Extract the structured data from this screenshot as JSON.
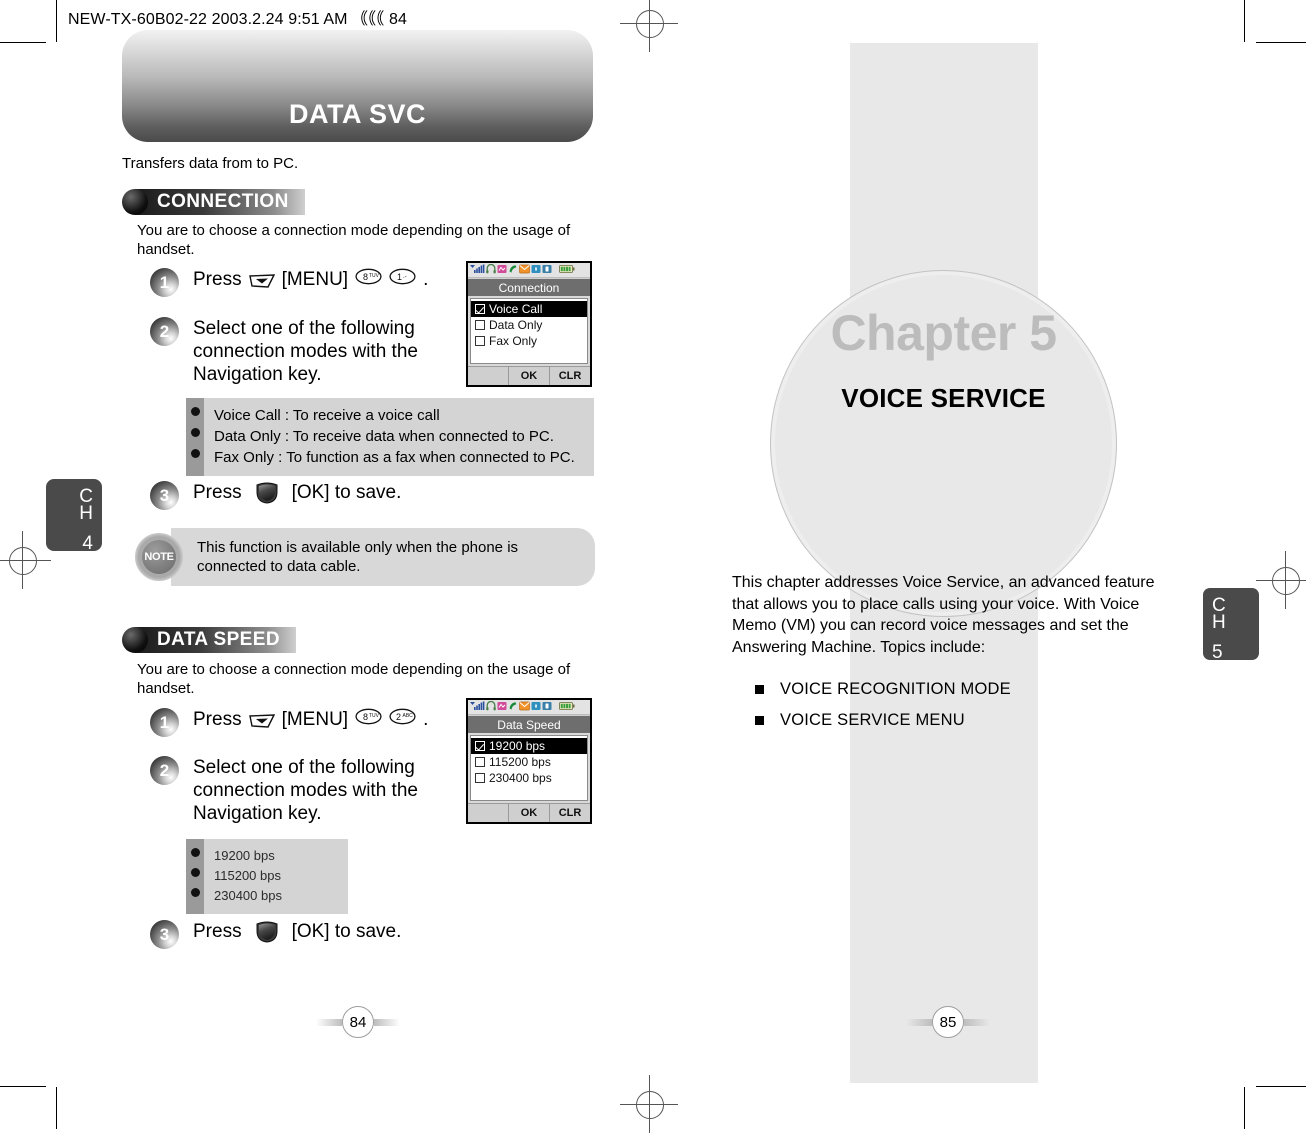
{
  "meta": {
    "header_line": "NEW-TX-60B02-22  2003.2.24 9:51 AM  ｟｟｟ 84"
  },
  "left_page": {
    "chapter_tab": {
      "ch": "C\nH",
      "ch_line1": "C",
      "ch_line2": "H",
      "number": "4"
    },
    "title": "DATA SVC",
    "intro": "Transfers data from to PC.",
    "page_number": "84",
    "sections": [
      {
        "heading": "CONNECTION",
        "description": "You are to choose a connection mode depending on the usage of handset.",
        "steps": [
          {
            "num": "1",
            "text_before": "Press",
            "key_soft": "softkey-down",
            "label_menu": "[MENU]",
            "key_1_digit": "8",
            "key_1_letters": "TUV",
            "key_2_digit": "1",
            "key_2_letters": ".-",
            "text_after": "."
          },
          {
            "num": "2",
            "text": "Select one of the following connection modes with the Navigation key."
          },
          {
            "num": "3",
            "text_before": "Press",
            "key_ok": "ok-key",
            "text_after": "[OK] to save."
          }
        ],
        "info_items": [
          "Voice Call : To receive a voice call",
          "Data Only : To receive data when connected to PC.",
          "Fax Only : To function as a fax when connected to PC."
        ],
        "note": {
          "badge": "NOTE",
          "text": "This function is available only when the phone is connected to data cable."
        },
        "phone": {
          "title": "Connection",
          "items": [
            {
              "label": "Voice Call",
              "checked": true,
              "selected": true
            },
            {
              "label": "Data Only",
              "checked": false,
              "selected": false
            },
            {
              "label": "Fax Only",
              "checked": false,
              "selected": false
            }
          ],
          "softkeys": [
            "",
            "OK",
            "CLR"
          ]
        }
      },
      {
        "heading": "DATA SPEED",
        "description": "You are to choose a connection mode depending on the usage of handset.",
        "steps": [
          {
            "num": "1",
            "text_before": "Press",
            "key_soft": "softkey-down",
            "label_menu": "[MENU]",
            "key_1_digit": "8",
            "key_1_letters": "TUV",
            "key_2_digit": "2",
            "key_2_letters": "ABC",
            "text_after": "."
          },
          {
            "num": "2",
            "text": "Select one of the following connection modes with the Navigation key."
          },
          {
            "num": "3",
            "text_before": "Press",
            "key_ok": "ok-key",
            "text_after": "[OK] to save."
          }
        ],
        "info_items": [
          "19200 bps",
          "115200 bps",
          "230400 bps"
        ],
        "phone": {
          "title": "Data Speed",
          "items": [
            {
              "label": "19200 bps",
              "checked": true,
              "selected": true
            },
            {
              "label": "115200 bps",
              "checked": false,
              "selected": false
            },
            {
              "label": "230400 bps",
              "checked": false,
              "selected": false
            }
          ],
          "softkeys": [
            "",
            "OK",
            "CLR"
          ]
        }
      }
    ]
  },
  "right_page": {
    "chapter_tab": {
      "ch_line1": "C",
      "ch_line2": "H",
      "number": "5"
    },
    "chapter_label": "Chapter 5",
    "chapter_title": "VOICE SERVICE",
    "intro": "This chapter addresses Voice Service, an advanced feature that allows you to place calls using your voice. With Voice Memo (VM) you can record voice messages and set the Answering Machine. Topics include:",
    "topics": [
      "VOICE RECOGNITION MODE",
      "VOICE SERVICE MENU"
    ],
    "page_number": "85"
  },
  "colors": {
    "tab_bg": "#4a4a4a",
    "info_box_bg": "#d4d4d4",
    "info_gutter": "#9a9a9a",
    "note_bg": "#d8d8d8",
    "gray_band": "#e8e8e8",
    "chapter_gray": "#bcbcbc",
    "phone_title_bg": "#6e6e6e"
  }
}
